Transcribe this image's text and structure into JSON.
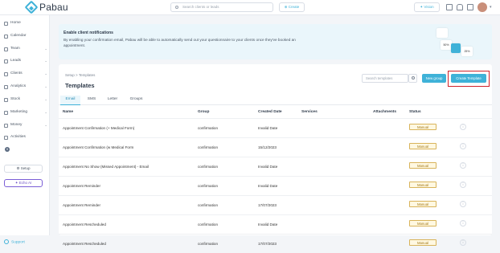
{
  "brand": {
    "name": "Pabau"
  },
  "topbar": {
    "search_placeholder": "Search clients or leads",
    "create_label": "Create",
    "vision_label": "Vision"
  },
  "sidebar": {
    "items": [
      {
        "label": "Home",
        "chev": ""
      },
      {
        "label": "Calendar",
        "chev": ""
      },
      {
        "label": "Team",
        "chev": "⌄"
      },
      {
        "label": "Leads",
        "chev": "⌄"
      },
      {
        "label": "Clients",
        "chev": "⌄"
      },
      {
        "label": "Analytics",
        "chev": "⌄"
      },
      {
        "label": "Stock",
        "chev": "⌄"
      },
      {
        "label": "Marketing",
        "chev": "⌄"
      },
      {
        "label": "Money",
        "chev": "⌄"
      },
      {
        "label": "Activities",
        "chev": ""
      }
    ],
    "activities_badge": "9",
    "setup_label": "Setup",
    "echo_label": "Echo AI",
    "support_label": "Support"
  },
  "banner": {
    "title": "Enable client notifications",
    "text": "By enabling your confirmation email, Pabau will be able to automatically send out your questionnaire to your clients once they've booked an appointment.",
    "card1": "50%",
    "card2": "25%"
  },
  "page": {
    "crumb_root": "Setup",
    "crumb_sep": ">",
    "crumb_current": "Templates",
    "title": "Templates",
    "search_placeholder": "Search templates",
    "new_group_label": "New group",
    "create_template_label": "Create Template"
  },
  "tabs": [
    "Email",
    "SMS",
    "Letter",
    "Groups"
  ],
  "columns": {
    "name": "Name",
    "group": "Group",
    "created": "Created Date",
    "services": "Services",
    "attachments": "Attachments",
    "status": "Status"
  },
  "rows": [
    {
      "name": "Appointment Confirmation (+ Medical Form)",
      "group": "confirmation",
      "created": "Invalid Date",
      "status": "Manual"
    },
    {
      "name": "Appointment Confirmation (w Medical Form",
      "group": "confirmation",
      "created": "15/12/2023",
      "status": "Manual"
    },
    {
      "name": "Appointment No Show (Missed Appointment) - Email",
      "group": "confirmation",
      "created": "Invalid Date",
      "status": "Manual"
    },
    {
      "name": "Appointment Reminder",
      "group": "confirmation",
      "created": "Invalid Date",
      "status": "Manual"
    },
    {
      "name": "Appointment Reminder",
      "group": "confirmation",
      "created": "17/07/2023",
      "status": "Manual"
    },
    {
      "name": "Appointment Rescheduled",
      "group": "confirmation",
      "created": "Invalid Date",
      "status": "Manual"
    },
    {
      "name": "Appointment Rescheduled",
      "group": "confirmation",
      "created": "17/07/2023",
      "status": "Manual"
    }
  ],
  "colors": {
    "accent": "#3fb2d8",
    "highlight": "#d0232b",
    "status_border": "#d8b35a"
  }
}
